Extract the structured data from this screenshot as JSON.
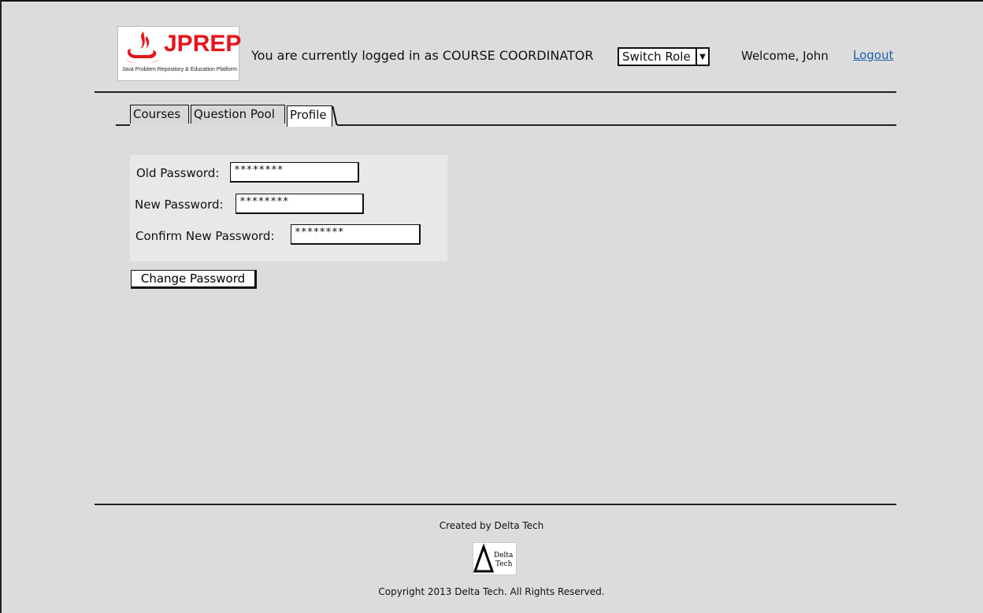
{
  "header": {
    "logo_word": "JPREP",
    "logo_subtitle": "Java Problem Repository & Education Platform",
    "role_text": "You are currently logged in as COURSE COORDINATOR",
    "switch_role_label": "Switch Role",
    "welcome_text": "Welcome, John",
    "logout_label": "Logout"
  },
  "tabs": [
    {
      "label": "Courses",
      "active": false
    },
    {
      "label": "Question Pool",
      "active": false
    },
    {
      "label": "Profile",
      "active": true
    }
  ],
  "form": {
    "old_password": {
      "label": "Old Password:",
      "value": "********"
    },
    "new_password": {
      "label": "New Password:",
      "value": "********"
    },
    "confirm_password": {
      "label": "Confirm New Password:",
      "value": "********"
    },
    "submit_label": "Change Password"
  },
  "footer": {
    "created_by": "Created by Delta Tech",
    "logo_text_1": "Delta",
    "logo_text_2": "Tech",
    "copyright": "Copyright 2013 Delta Tech. All Rights Reserved."
  },
  "colors": {
    "background": "#dcdcdc",
    "logo_red": "#e8141b",
    "link_blue": "#1f5fb2"
  }
}
